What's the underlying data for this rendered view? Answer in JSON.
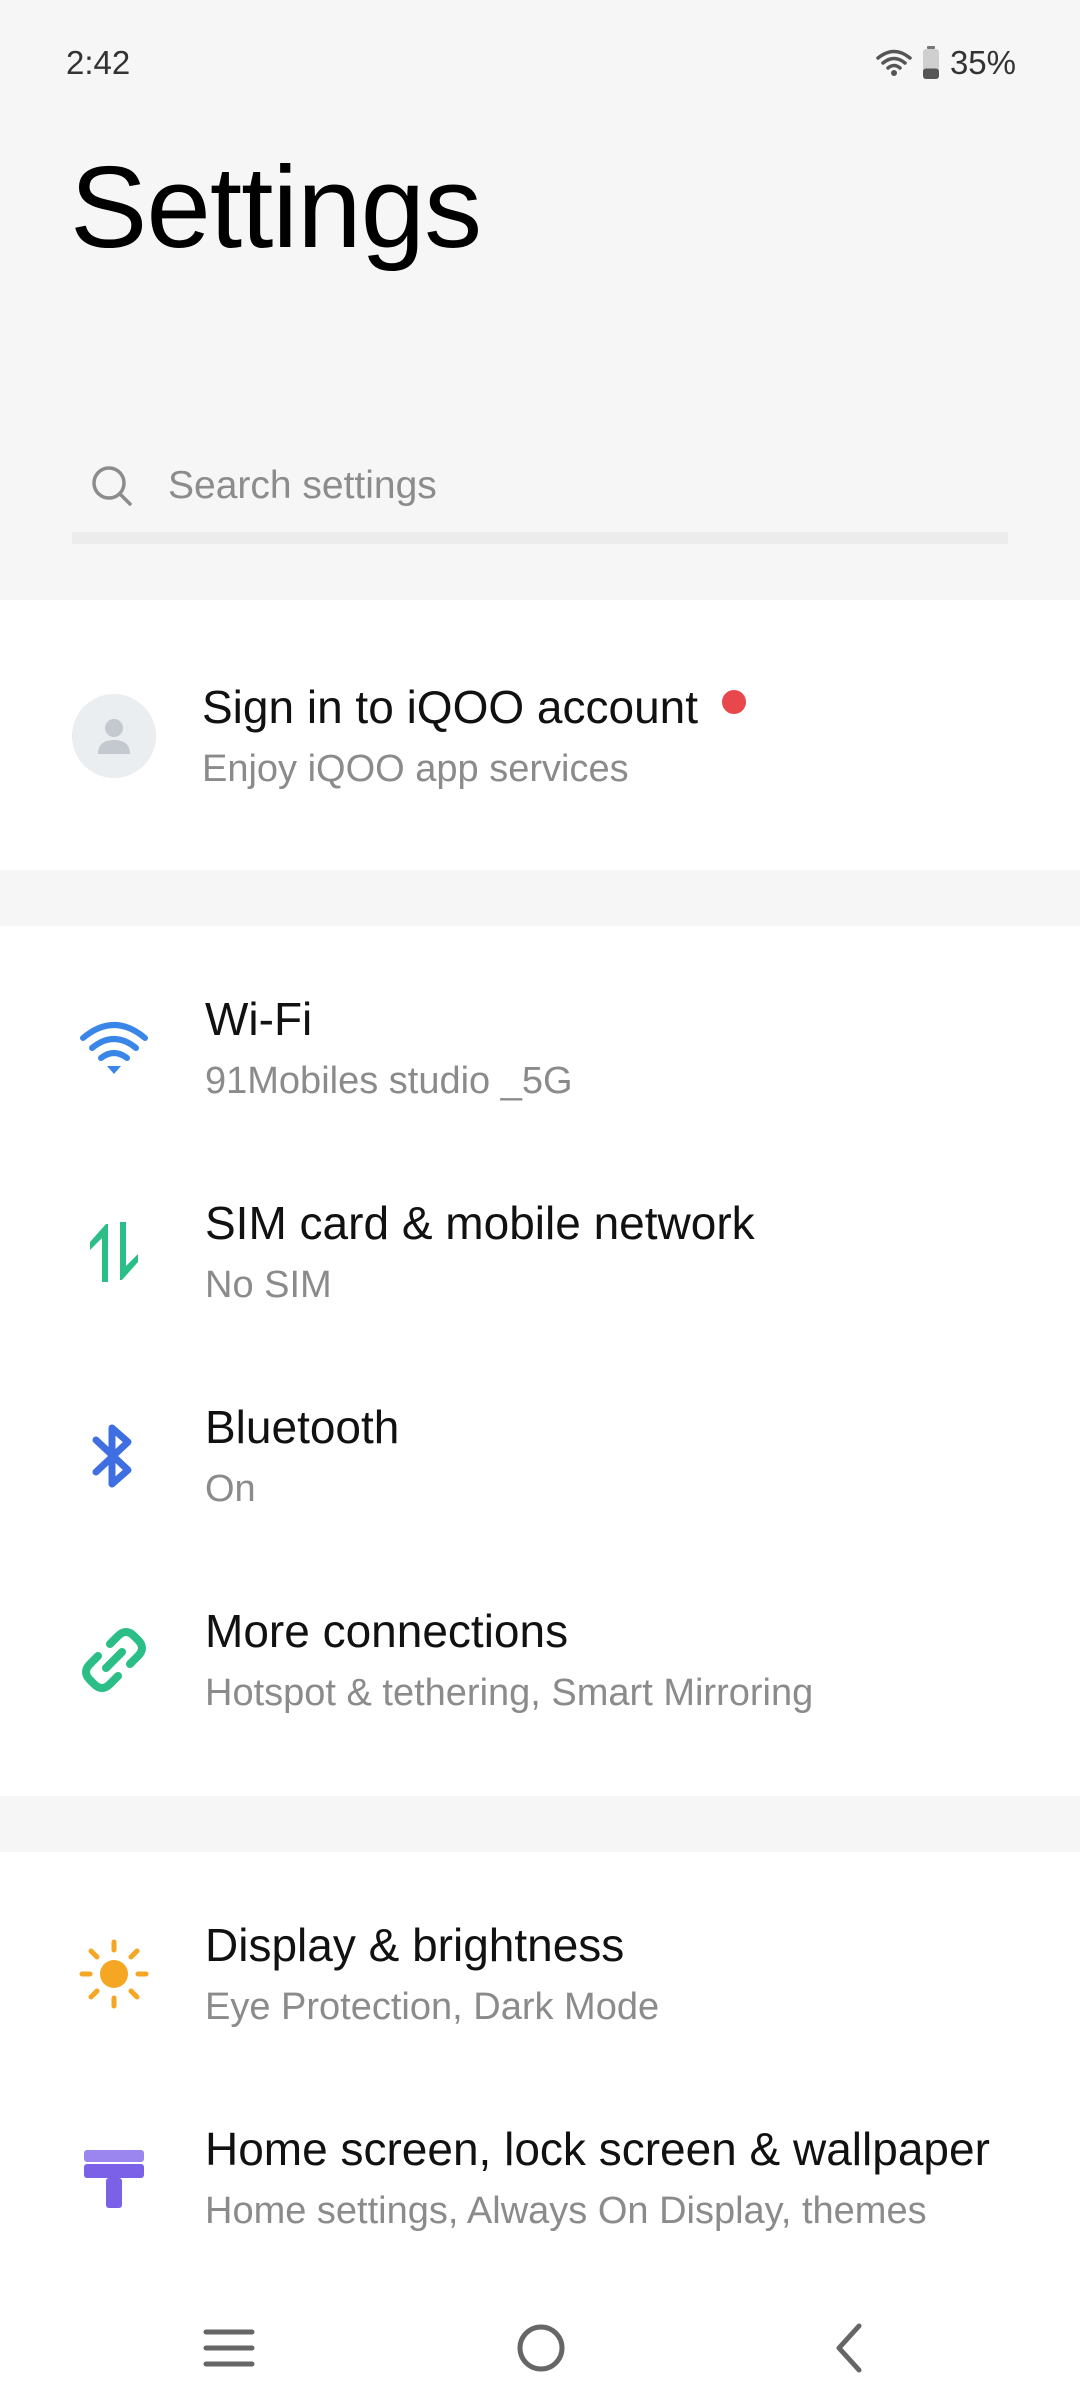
{
  "status_bar": {
    "time": "2:42",
    "battery_percent": "35%",
    "battery_level": 0.35,
    "icons": [
      "wifi-signal-icon",
      "battery-icon"
    ]
  },
  "page": {
    "title": "Settings"
  },
  "search": {
    "placeholder": "Search settings",
    "icon": "search-icon"
  },
  "account": {
    "title": "Sign in to iQOO account",
    "subtitle": "Enjoy iQOO app services",
    "icon": "person-icon",
    "badge_color": "#e8474c"
  },
  "connections": [
    {
      "title": "Wi-Fi",
      "subtitle": "91Mobiles studio _5G",
      "icon": "wifi-icon",
      "color": "#3a86e8"
    },
    {
      "title": "SIM card & mobile network",
      "subtitle": "No SIM",
      "icon": "mobile-data-icon",
      "color": "#2bbf87"
    },
    {
      "title": "Bluetooth",
      "subtitle": "On",
      "icon": "bluetooth-icon",
      "color": "#3f6ee0"
    },
    {
      "title": "More connections",
      "subtitle": "Hotspot & tethering, Smart Mirroring",
      "icon": "link-icon",
      "color": "#2bbf87"
    }
  ],
  "display": [
    {
      "title": "Display & brightness",
      "subtitle": "Eye Protection, Dark Mode",
      "icon": "sun-icon",
      "color": "#f5a623"
    },
    {
      "title": "Home screen, lock screen & wallpaper",
      "subtitle": "Home settings, Always On Display, themes",
      "icon": "wallpaper-icon",
      "color": "#7b61e8"
    }
  ],
  "nav_bar": {
    "icons": [
      "menu-icon",
      "home-icon",
      "back-icon"
    ]
  },
  "colors": {
    "background": "#f6f6f6",
    "card": "#ffffff",
    "subtitle": "#8b8b8b"
  }
}
